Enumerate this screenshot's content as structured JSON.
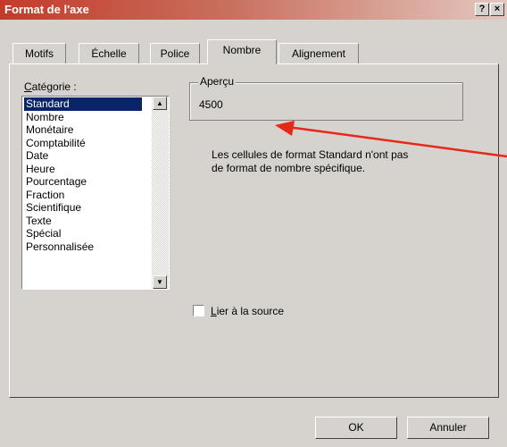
{
  "window": {
    "title": "Format de l'axe",
    "help_label": "?",
    "close_label": "×"
  },
  "tabs": [
    {
      "label": "Motifs"
    },
    {
      "label": "Échelle"
    },
    {
      "label": "Police"
    },
    {
      "label": "Nombre",
      "active": true
    },
    {
      "label": "Alignement"
    }
  ],
  "category": {
    "label_first": "C",
    "label_rest": "atégorie :",
    "items": [
      "Standard",
      "Nombre",
      "Monétaire",
      "Comptabilité",
      "Date",
      "Heure",
      "Pourcentage",
      "Fraction",
      "Scientifique",
      "Texte",
      "Spécial",
      "Personnalisée"
    ],
    "selected": "Standard"
  },
  "preview": {
    "label": "Aperçu",
    "value": "4500"
  },
  "description": "Les cellules de format Standard n'ont pas de format de nombre spécifique.",
  "link_source": {
    "label_first": "L",
    "label_rest": "ier à la source",
    "checked": false
  },
  "buttons": {
    "ok": "OK",
    "cancel": "Annuler"
  },
  "annotation": {
    "color": "#e8261a"
  },
  "icons": {
    "scroll_up": "arrow-up-icon",
    "scroll_down": "arrow-down-icon",
    "help": "help-icon",
    "close": "close-icon"
  }
}
